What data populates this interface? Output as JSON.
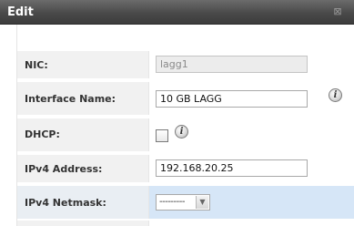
{
  "dialog": {
    "title": "Edit",
    "close_glyph": "⊠"
  },
  "fields": {
    "nic": {
      "label": "NIC:",
      "value": "lagg1"
    },
    "interface_name": {
      "label": "Interface Name:",
      "value": "10 GB LAGG"
    },
    "dhcp": {
      "label": "DHCP:",
      "checked": false
    },
    "ipv4_address": {
      "label": "IPv4 Address:",
      "value": "192.168.20.25"
    },
    "ipv4_netmask": {
      "label": "IPv4 Netmask:",
      "value": "---------"
    }
  },
  "icons": {
    "info": "i"
  },
  "colors": {
    "titlebar": "#4a4a4a",
    "highlight_row": "#d6e6f7",
    "label_cell": "#f1f1f1"
  }
}
